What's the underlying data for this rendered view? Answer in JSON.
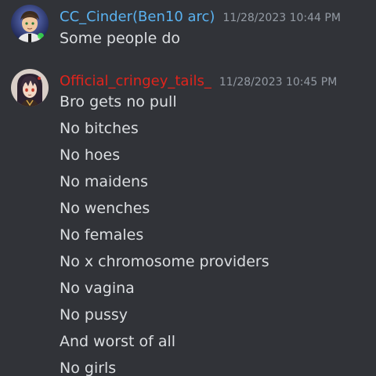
{
  "messages": [
    {
      "username": "CC_Cinder(Ben10 arc)",
      "username_color": "#5ab2f0",
      "timestamp": "11/28/2023 10:44 PM",
      "avatar_icon": "ben10-character-avatar",
      "lines": [
        "Some people do"
      ]
    },
    {
      "username": "Official_cringey_tails_",
      "username_color": "#e0241c",
      "timestamp": "11/28/2023 10:45 PM",
      "avatar_icon": "anime-character-avatar",
      "lines": [
        "Bro gets no pull",
        "No bitches",
        "No hoes",
        "No maidens",
        "No wenches",
        "No females",
        "No x chromosome providers",
        "No vagina",
        "No pussy",
        "And worst of all",
        "No girls"
      ]
    }
  ]
}
